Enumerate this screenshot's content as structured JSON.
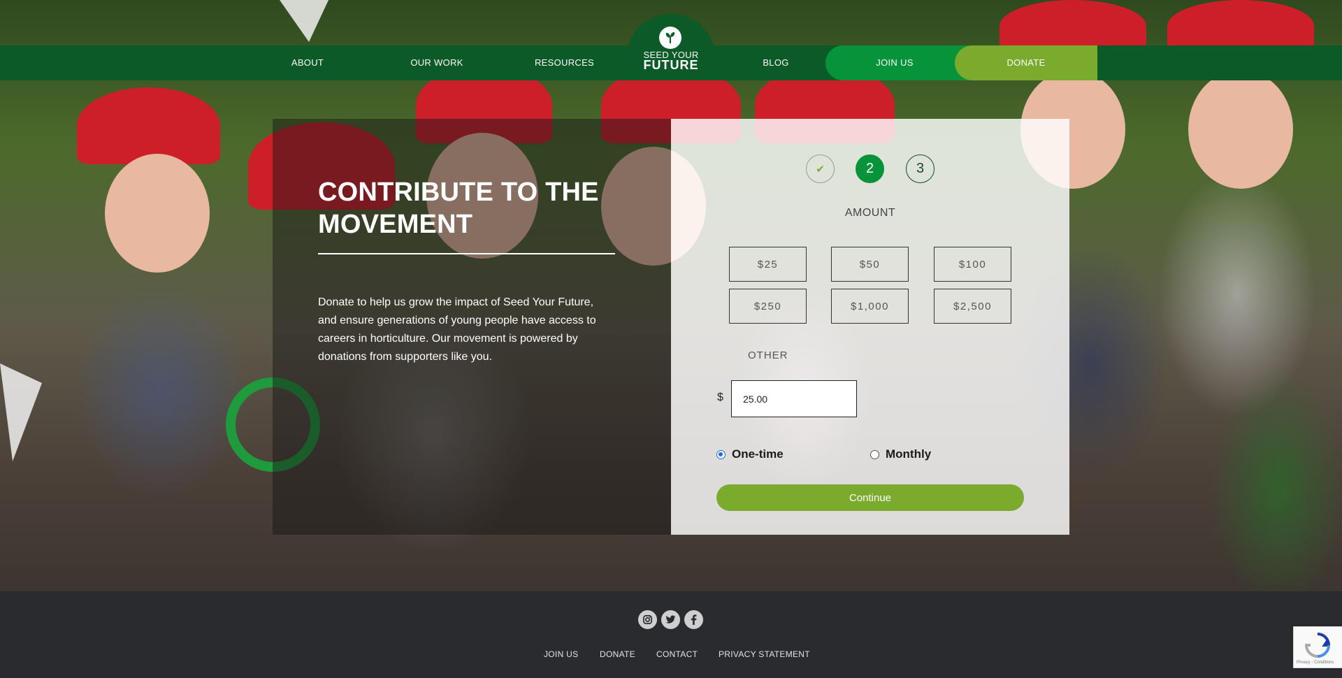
{
  "nav": {
    "items": [
      "ABOUT",
      "OUR WORK",
      "RESOURCES",
      "BLOG"
    ],
    "join": "JOIN US",
    "donate": "DONATE"
  },
  "logo": {
    "line1": "SEED YOUR",
    "line2": "FUTURE"
  },
  "card": {
    "headline_line1": "CONTRIBUTE TO THE",
    "headline_line2": "MOVEMENT",
    "intro": "Donate to help us grow the impact of Seed Your Future, and ensure generations of young people have access to careers in horticulture. Our movement is powered by donations from supporters like you."
  },
  "form": {
    "steps": [
      {
        "label": "✔",
        "state": "complete"
      },
      {
        "label": "2",
        "state": "current"
      },
      {
        "label": "3",
        "state": "upcoming"
      }
    ],
    "amount_label": "AMOUNT",
    "amounts": [
      "$25",
      "$50",
      "$100",
      "$250",
      "$1,000",
      "$2,500"
    ],
    "other_label": "OTHER",
    "currency_symbol": "$",
    "other_value": "25.00",
    "frequency": [
      {
        "label": "One-time",
        "selected": true
      },
      {
        "label": "Monthly",
        "selected": false
      }
    ],
    "continue_label": "Continue"
  },
  "footer": {
    "social": [
      "instagram-icon",
      "twitter-icon",
      "facebook-icon"
    ],
    "links": [
      "JOIN US",
      "DONATE",
      "CONTACT",
      "PRIVACY STATEMENT"
    ]
  },
  "recaptcha": {
    "text": "Privacy - Conditions"
  },
  "colors": {
    "nav_green": "#0b5a27",
    "join_green": "#069339",
    "donate_lime": "#7bab2c",
    "footer": "#2a2b2e"
  }
}
